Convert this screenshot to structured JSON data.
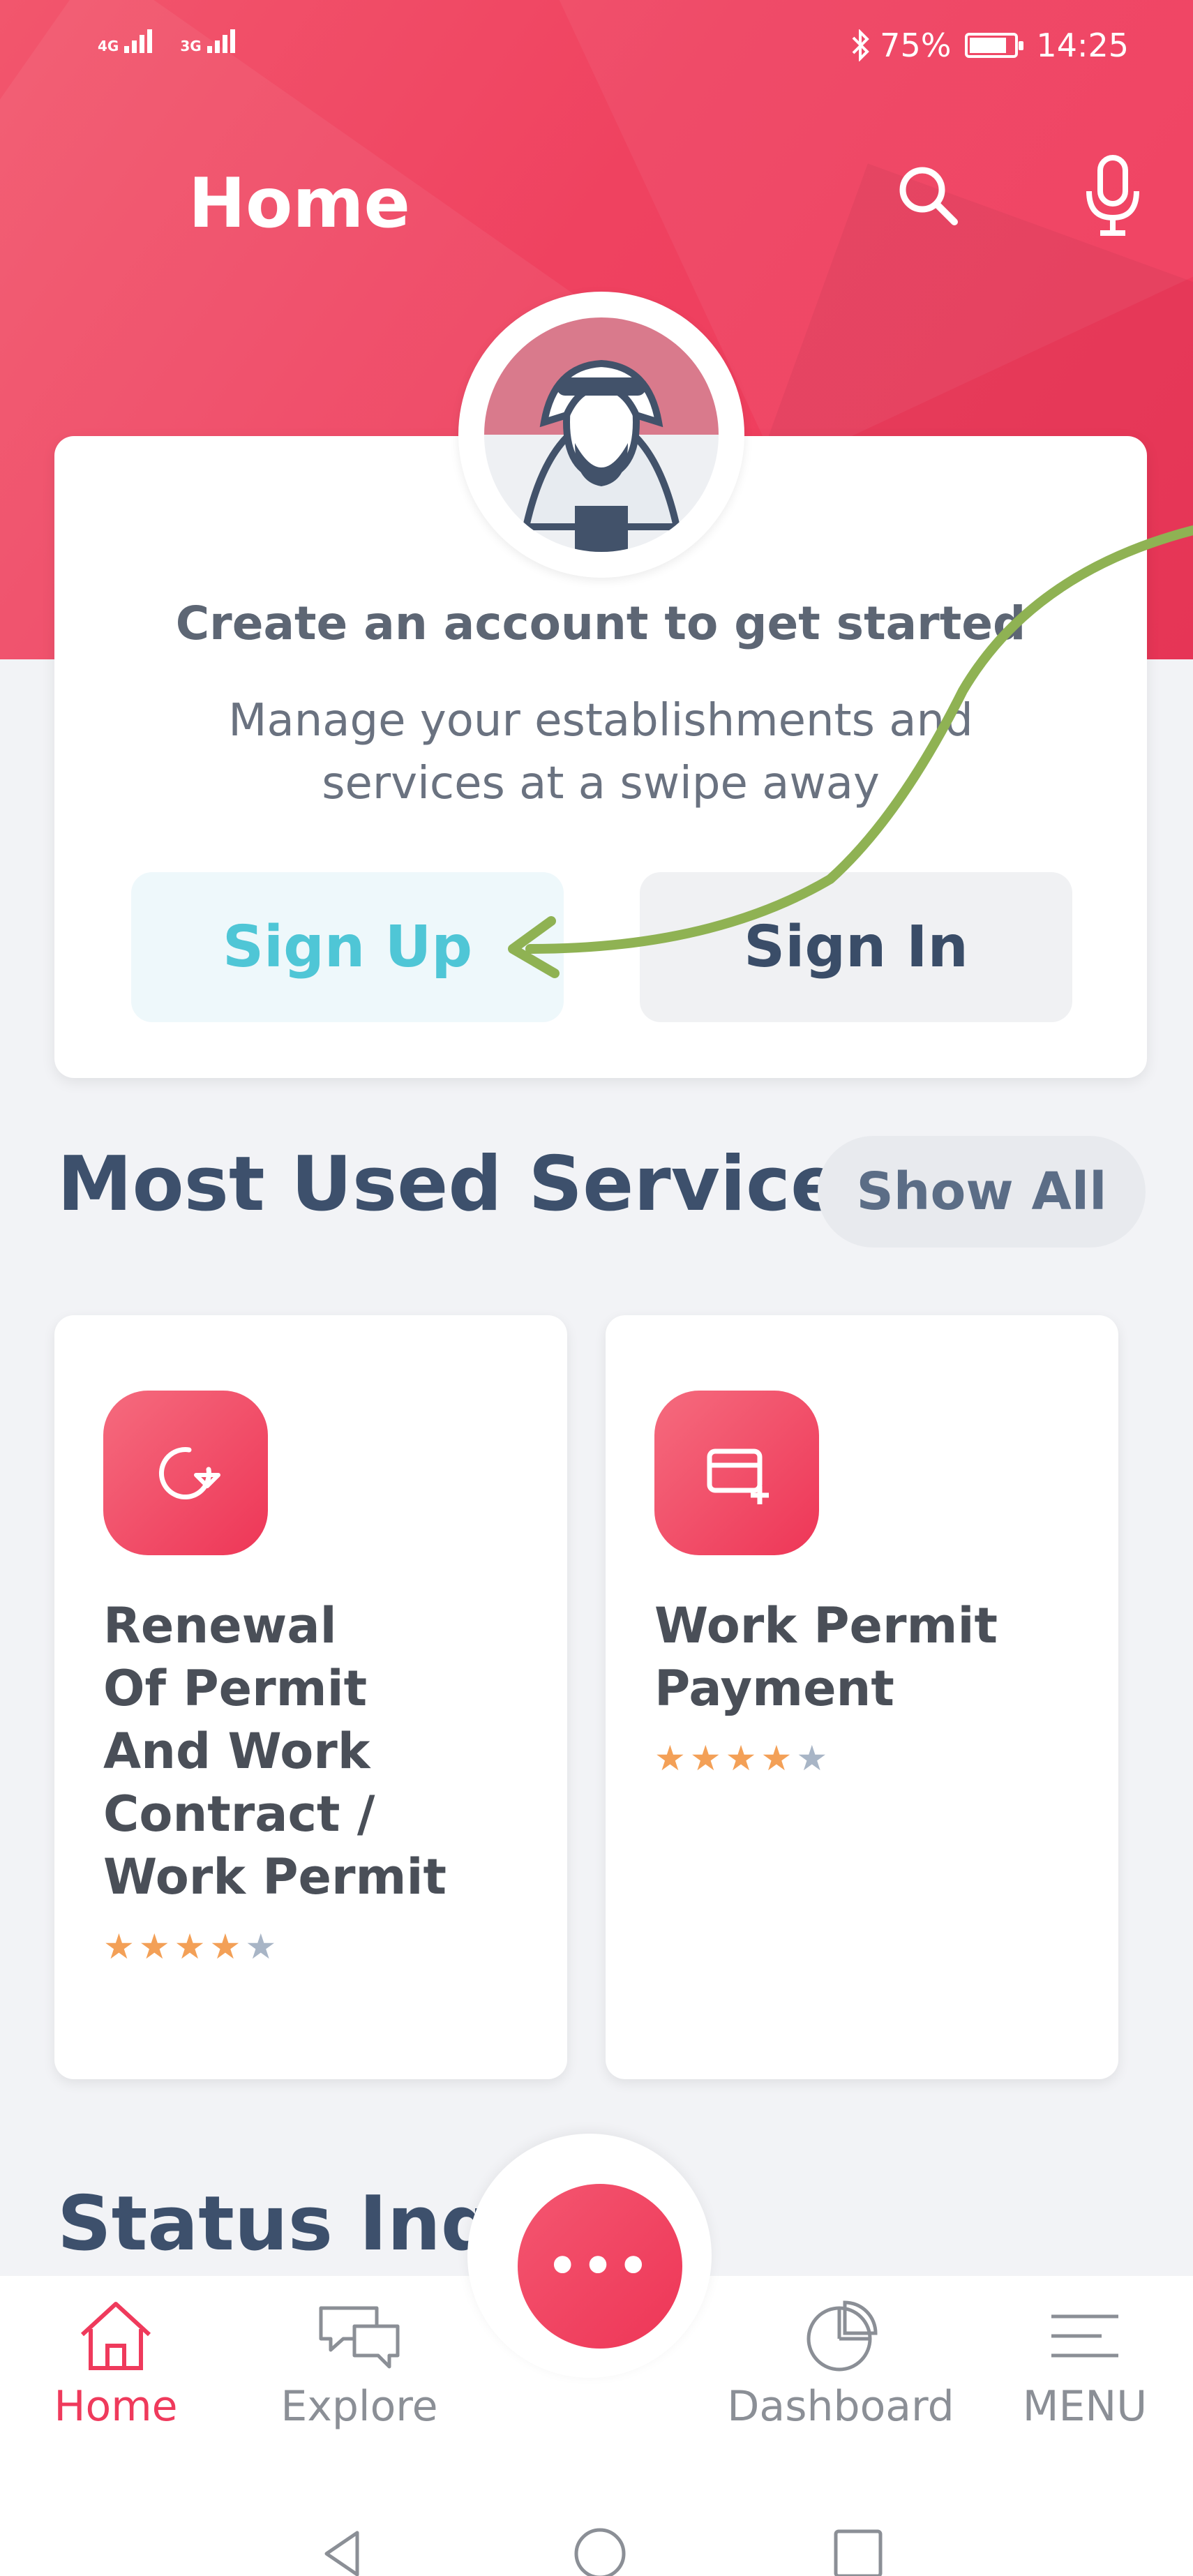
{
  "status_bar": {
    "signal_1": "4G",
    "signal_2": "3G",
    "battery_percent": "75%",
    "time": "14:25",
    "icons": [
      "signal-icon",
      "bluetooth-icon",
      "battery-icon"
    ]
  },
  "header": {
    "title": "Home",
    "search_icon": "search-icon",
    "mic_icon": "microphone-icon",
    "accent_color": "#f0405e"
  },
  "account_card": {
    "avatar_icon": "avatar-icon",
    "heading": "Create an account to get started",
    "subtitle_line1": "Manage your establishments and",
    "subtitle_line2": "services at a swipe away",
    "signup_label": "Sign Up",
    "signin_label": "Sign In",
    "annotation": "arrow-pointing-to-sign-up"
  },
  "most_used": {
    "title": "Most Used Services",
    "show_all_label": "Show All",
    "services": [
      {
        "icon": "renew-icon",
        "title_lines": [
          "Renewal",
          "Of Permit",
          "And Work",
          "Contract /",
          "Work Permit"
        ],
        "rating": 4,
        "rating_max": 5
      },
      {
        "icon": "card-payment-icon",
        "title_lines": [
          "Work Permit",
          "Payment"
        ],
        "rating": 4,
        "rating_max": 5
      }
    ]
  },
  "status_inquiry": {
    "title": "Status Inquiry"
  },
  "bottom_nav": {
    "items": [
      {
        "label": "Home",
        "icon": "home-icon",
        "active": true
      },
      {
        "label": "Explore",
        "icon": "chat-bubbles-icon",
        "active": false
      },
      {
        "label": "Dashboard",
        "icon": "pie-chart-icon",
        "active": false
      },
      {
        "label": "MENU",
        "icon": "menu-icon",
        "active": false
      }
    ],
    "fab_icon": "more-dots-icon"
  },
  "system_nav": [
    "back-icon",
    "home-circle-icon",
    "recents-icon"
  ]
}
